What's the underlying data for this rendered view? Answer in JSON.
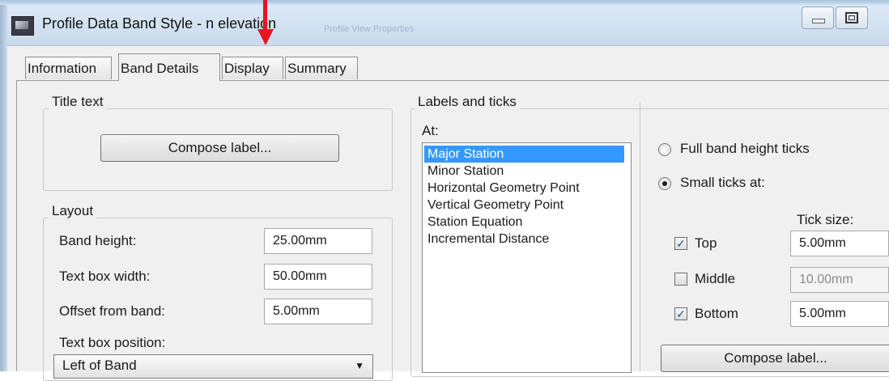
{
  "window": {
    "title": "Profile Data Band Style - n elevation",
    "ghost_title": "Profile View Properties"
  },
  "tabs": [
    {
      "label": "Information"
    },
    {
      "label": "Band Details"
    },
    {
      "label": "Display"
    },
    {
      "label": "Summary"
    }
  ],
  "active_tab": "Band Details",
  "title_text": {
    "group_label": "Title text",
    "compose_label": "Compose label..."
  },
  "layout": {
    "group_label": "Layout",
    "band_height_label": "Band height:",
    "band_height_value": "25.00mm",
    "text_box_width_label": "Text box width:",
    "text_box_width_value": "50.00mm",
    "offset_label": "Offset from band:",
    "offset_value": "5.00mm",
    "position_label": "Text box position:",
    "position_value": "Left of Band"
  },
  "labels_ticks": {
    "group_label": "Labels and ticks",
    "at_label": "At:",
    "items": [
      "Major Station",
      "Minor Station",
      "Horizontal Geometry Point",
      "Vertical Geometry Point",
      "Station Equation",
      "Incremental Distance"
    ],
    "selected_index": 0
  },
  "ticks": {
    "full_band_label": "Full band height ticks",
    "small_ticks_label": "Small ticks at:",
    "selected": "Small ticks at:",
    "tick_size_label": "Tick size:",
    "top": {
      "label": "Top",
      "checked": true,
      "value": "5.00mm"
    },
    "middle": {
      "label": "Middle",
      "checked": false,
      "value": "10.00mm"
    },
    "bottom": {
      "label": "Bottom",
      "checked": true,
      "value": "5.00mm"
    },
    "compose_label": "Compose label..."
  },
  "annotation": {
    "arrow_color": "#e8141e"
  },
  "colors": {
    "selection": "#3399ff",
    "titlebar": "#d4e3f2"
  }
}
